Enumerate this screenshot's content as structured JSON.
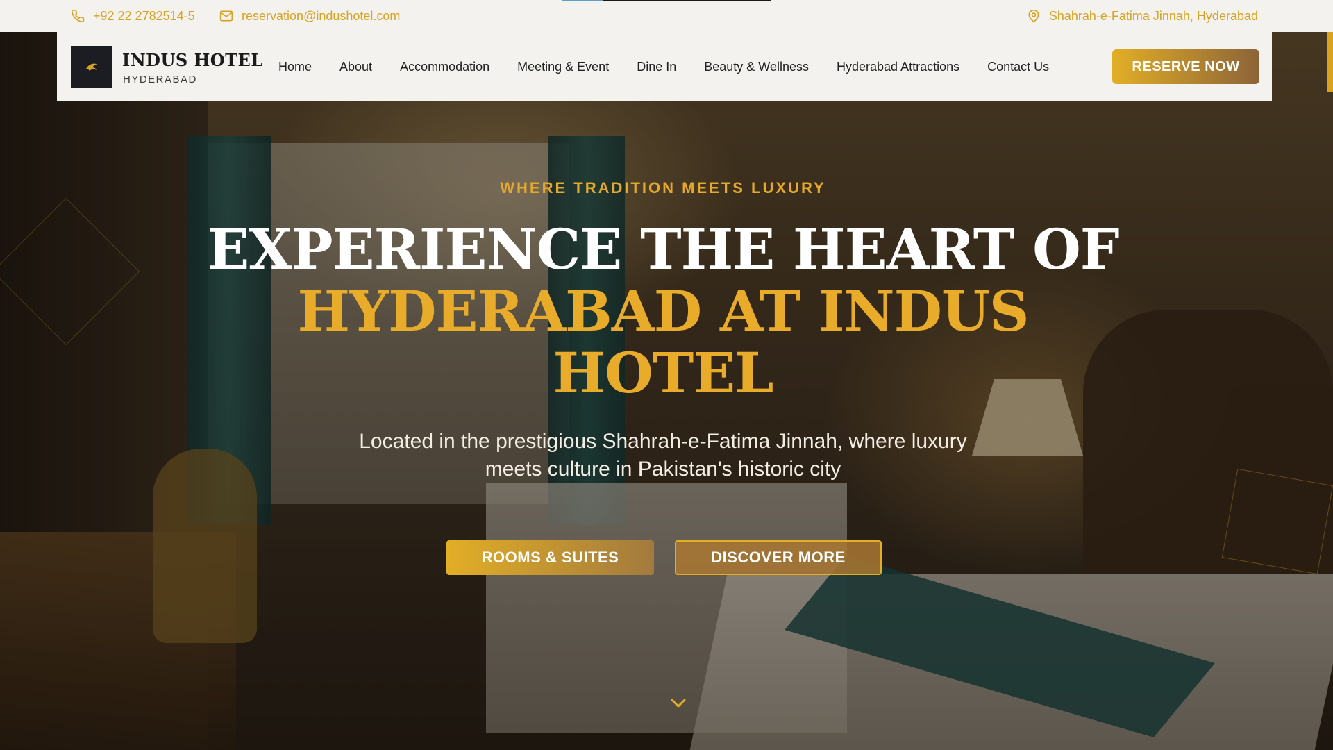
{
  "topbar": {
    "phone": "+92 22 2782514-5",
    "email": "reservation@indushotel.com",
    "address": "Shahrah-e-Fatima Jinnah, Hyderabad"
  },
  "brand": {
    "name": "INDUS HOTEL",
    "sub": "HYDERABAD"
  },
  "nav": {
    "items": [
      "Home",
      "About",
      "Accommodation",
      "Meeting & Event",
      "Dine In",
      "Beauty & Wellness",
      "Hyderabad Attractions",
      "Contact Us"
    ],
    "reserve_label": "RESERVE NOW"
  },
  "hero": {
    "tagline": "WHERE TRADITION MEETS LUXURY",
    "headline_white": "EXPERIENCE THE HEART OF",
    "headline_gold_1": "HYDERABAD AT INDUS",
    "headline_gold_2": "HOTEL",
    "subtitle": "Located in the prestigious Shahrah-e-Fatima Jinnah, where luxury meets culture in Pakistan's historic city",
    "btn_rooms": "ROOMS & SUITES",
    "btn_discover": "DISCOVER MORE"
  },
  "icons": {
    "phone": "phone-icon",
    "email": "mail-icon",
    "address": "map-pin-icon",
    "scroll": "chevron-down-icon"
  },
  "colors": {
    "accent": "#d9a321",
    "topbar_bg": "#f3f2ef",
    "logo_bg": "#1b1d22"
  }
}
